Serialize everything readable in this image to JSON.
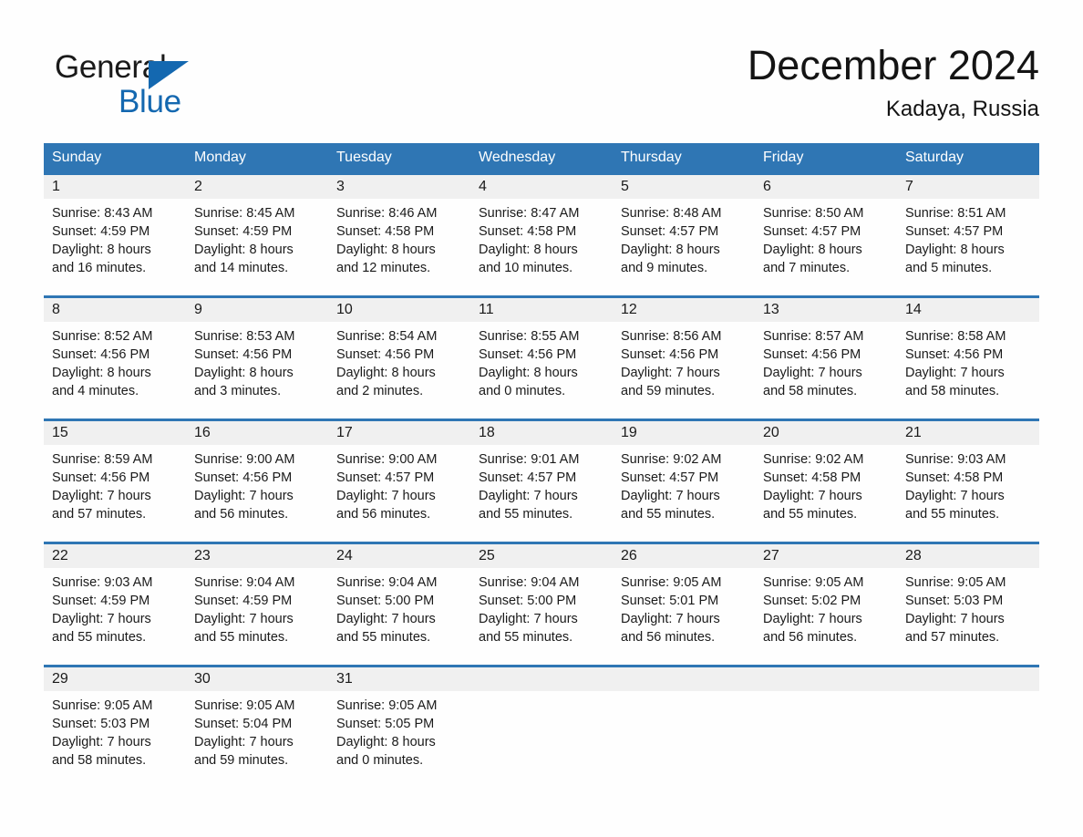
{
  "logo": {
    "word_one": "General",
    "word_two": "Blue",
    "triangle_icon": "triangle-icon",
    "brand_blue": "#1468b0"
  },
  "header": {
    "month_title": "December 2024",
    "location": "Kadaya, Russia"
  },
  "colors": {
    "header_blue": "#2f76b4",
    "day_band_gray": "#f0f0f0",
    "text": "#1a1a1a",
    "page_background": "#fefefe"
  },
  "calendar": {
    "weekdays": [
      "Sunday",
      "Monday",
      "Tuesday",
      "Wednesday",
      "Thursday",
      "Friday",
      "Saturday"
    ],
    "weeks": [
      [
        {
          "day": "1",
          "sunrise": "Sunrise: 8:43 AM",
          "sunset": "Sunset: 4:59 PM",
          "daylight_1": "Daylight: 8 hours",
          "daylight_2": "and 16 minutes."
        },
        {
          "day": "2",
          "sunrise": "Sunrise: 8:45 AM",
          "sunset": "Sunset: 4:59 PM",
          "daylight_1": "Daylight: 8 hours",
          "daylight_2": "and 14 minutes."
        },
        {
          "day": "3",
          "sunrise": "Sunrise: 8:46 AM",
          "sunset": "Sunset: 4:58 PM",
          "daylight_1": "Daylight: 8 hours",
          "daylight_2": "and 12 minutes."
        },
        {
          "day": "4",
          "sunrise": "Sunrise: 8:47 AM",
          "sunset": "Sunset: 4:58 PM",
          "daylight_1": "Daylight: 8 hours",
          "daylight_2": "and 10 minutes."
        },
        {
          "day": "5",
          "sunrise": "Sunrise: 8:48 AM",
          "sunset": "Sunset: 4:57 PM",
          "daylight_1": "Daylight: 8 hours",
          "daylight_2": "and 9 minutes."
        },
        {
          "day": "6",
          "sunrise": "Sunrise: 8:50 AM",
          "sunset": "Sunset: 4:57 PM",
          "daylight_1": "Daylight: 8 hours",
          "daylight_2": "and 7 minutes."
        },
        {
          "day": "7",
          "sunrise": "Sunrise: 8:51 AM",
          "sunset": "Sunset: 4:57 PM",
          "daylight_1": "Daylight: 8 hours",
          "daylight_2": "and 5 minutes."
        }
      ],
      [
        {
          "day": "8",
          "sunrise": "Sunrise: 8:52 AM",
          "sunset": "Sunset: 4:56 PM",
          "daylight_1": "Daylight: 8 hours",
          "daylight_2": "and 4 minutes."
        },
        {
          "day": "9",
          "sunrise": "Sunrise: 8:53 AM",
          "sunset": "Sunset: 4:56 PM",
          "daylight_1": "Daylight: 8 hours",
          "daylight_2": "and 3 minutes."
        },
        {
          "day": "10",
          "sunrise": "Sunrise: 8:54 AM",
          "sunset": "Sunset: 4:56 PM",
          "daylight_1": "Daylight: 8 hours",
          "daylight_2": "and 2 minutes."
        },
        {
          "day": "11",
          "sunrise": "Sunrise: 8:55 AM",
          "sunset": "Sunset: 4:56 PM",
          "daylight_1": "Daylight: 8 hours",
          "daylight_2": "and 0 minutes."
        },
        {
          "day": "12",
          "sunrise": "Sunrise: 8:56 AM",
          "sunset": "Sunset: 4:56 PM",
          "daylight_1": "Daylight: 7 hours",
          "daylight_2": "and 59 minutes."
        },
        {
          "day": "13",
          "sunrise": "Sunrise: 8:57 AM",
          "sunset": "Sunset: 4:56 PM",
          "daylight_1": "Daylight: 7 hours",
          "daylight_2": "and 58 minutes."
        },
        {
          "day": "14",
          "sunrise": "Sunrise: 8:58 AM",
          "sunset": "Sunset: 4:56 PM",
          "daylight_1": "Daylight: 7 hours",
          "daylight_2": "and 58 minutes."
        }
      ],
      [
        {
          "day": "15",
          "sunrise": "Sunrise: 8:59 AM",
          "sunset": "Sunset: 4:56 PM",
          "daylight_1": "Daylight: 7 hours",
          "daylight_2": "and 57 minutes."
        },
        {
          "day": "16",
          "sunrise": "Sunrise: 9:00 AM",
          "sunset": "Sunset: 4:56 PM",
          "daylight_1": "Daylight: 7 hours",
          "daylight_2": "and 56 minutes."
        },
        {
          "day": "17",
          "sunrise": "Sunrise: 9:00 AM",
          "sunset": "Sunset: 4:57 PM",
          "daylight_1": "Daylight: 7 hours",
          "daylight_2": "and 56 minutes."
        },
        {
          "day": "18",
          "sunrise": "Sunrise: 9:01 AM",
          "sunset": "Sunset: 4:57 PM",
          "daylight_1": "Daylight: 7 hours",
          "daylight_2": "and 55 minutes."
        },
        {
          "day": "19",
          "sunrise": "Sunrise: 9:02 AM",
          "sunset": "Sunset: 4:57 PM",
          "daylight_1": "Daylight: 7 hours",
          "daylight_2": "and 55 minutes."
        },
        {
          "day": "20",
          "sunrise": "Sunrise: 9:02 AM",
          "sunset": "Sunset: 4:58 PM",
          "daylight_1": "Daylight: 7 hours",
          "daylight_2": "and 55 minutes."
        },
        {
          "day": "21",
          "sunrise": "Sunrise: 9:03 AM",
          "sunset": "Sunset: 4:58 PM",
          "daylight_1": "Daylight: 7 hours",
          "daylight_2": "and 55 minutes."
        }
      ],
      [
        {
          "day": "22",
          "sunrise": "Sunrise: 9:03 AM",
          "sunset": "Sunset: 4:59 PM",
          "daylight_1": "Daylight: 7 hours",
          "daylight_2": "and 55 minutes."
        },
        {
          "day": "23",
          "sunrise": "Sunrise: 9:04 AM",
          "sunset": "Sunset: 4:59 PM",
          "daylight_1": "Daylight: 7 hours",
          "daylight_2": "and 55 minutes."
        },
        {
          "day": "24",
          "sunrise": "Sunrise: 9:04 AM",
          "sunset": "Sunset: 5:00 PM",
          "daylight_1": "Daylight: 7 hours",
          "daylight_2": "and 55 minutes."
        },
        {
          "day": "25",
          "sunrise": "Sunrise: 9:04 AM",
          "sunset": "Sunset: 5:00 PM",
          "daylight_1": "Daylight: 7 hours",
          "daylight_2": "and 55 minutes."
        },
        {
          "day": "26",
          "sunrise": "Sunrise: 9:05 AM",
          "sunset": "Sunset: 5:01 PM",
          "daylight_1": "Daylight: 7 hours",
          "daylight_2": "and 56 minutes."
        },
        {
          "day": "27",
          "sunrise": "Sunrise: 9:05 AM",
          "sunset": "Sunset: 5:02 PM",
          "daylight_1": "Daylight: 7 hours",
          "daylight_2": "and 56 minutes."
        },
        {
          "day": "28",
          "sunrise": "Sunrise: 9:05 AM",
          "sunset": "Sunset: 5:03 PM",
          "daylight_1": "Daylight: 7 hours",
          "daylight_2": "and 57 minutes."
        }
      ],
      [
        {
          "day": "29",
          "sunrise": "Sunrise: 9:05 AM",
          "sunset": "Sunset: 5:03 PM",
          "daylight_1": "Daylight: 7 hours",
          "daylight_2": "and 58 minutes."
        },
        {
          "day": "30",
          "sunrise": "Sunrise: 9:05 AM",
          "sunset": "Sunset: 5:04 PM",
          "daylight_1": "Daylight: 7 hours",
          "daylight_2": "and 59 minutes."
        },
        {
          "day": "31",
          "sunrise": "Sunrise: 9:05 AM",
          "sunset": "Sunset: 5:05 PM",
          "daylight_1": "Daylight: 8 hours",
          "daylight_2": "and 0 minutes."
        },
        {
          "day": "",
          "sunrise": "",
          "sunset": "",
          "daylight_1": "",
          "daylight_2": ""
        },
        {
          "day": "",
          "sunrise": "",
          "sunset": "",
          "daylight_1": "",
          "daylight_2": ""
        },
        {
          "day": "",
          "sunrise": "",
          "sunset": "",
          "daylight_1": "",
          "daylight_2": ""
        },
        {
          "day": "",
          "sunrise": "",
          "sunset": "",
          "daylight_1": "",
          "daylight_2": ""
        }
      ]
    ]
  }
}
